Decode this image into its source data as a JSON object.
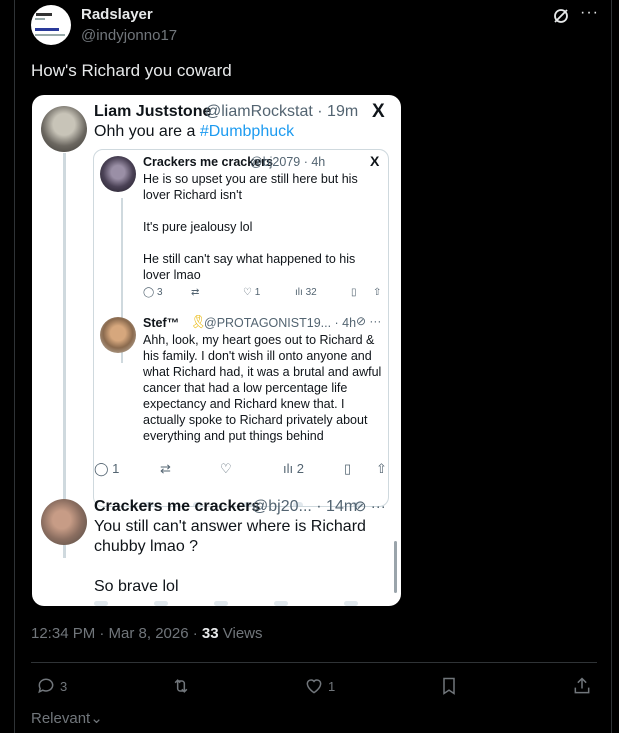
{
  "post": {
    "author_name": "Radslayer",
    "author_handle": "@indyjonno17",
    "avatar_lines": [
      "Trust Red",
      "Account suspended"
    ],
    "text": "How's Richard you coward",
    "timestamp": "12:34 PM · Mar 8, 2026 · ",
    "views_count": "33",
    "views_label": " Views",
    "stats": {
      "replies": "3",
      "likes": "1"
    },
    "sort_label": "Relevant"
  },
  "screenshot": {
    "main": {
      "name": "Liam Juststone",
      "meta": "@liamRockstat · 19m",
      "text_prefix": "Ohh you are a ",
      "hashtag": "#Dumbphuck",
      "x_logo": "X",
      "actions": {
        "replies": "1",
        "views": "2"
      }
    },
    "quoted": {
      "name": "Crackers me crackers",
      "meta": "@bj2079 · 4h",
      "x_logo": "X",
      "paragraphs": [
        "He is so upset you are still here but his lover Richard isn't",
        "It's pure jealousy lol",
        "He still can't say what happened to his lover lmao"
      ],
      "actions": {
        "replies": "3",
        "likes": "1",
        "views": "32"
      }
    },
    "quoted_reply": {
      "name": "Stef™",
      "meta": "@PROTAGONIST19... · 4h",
      "text": "Ahh, look, my heart goes out to Richard & his family. I don't wish ill onto anyone and what Richard had, it was a brutal and awful cancer that had a low percentage life expectancy and Richard knew that. I actually spoke to Richard privately about everything and put things behind"
    },
    "reply": {
      "name": "Crackers me crackers",
      "meta": "@bj20... · 14m",
      "paragraphs": [
        "You still can't answer where is Richard chubby lmao ?",
        "So brave lol"
      ]
    }
  },
  "colors": {
    "accent": "#1d9bf0",
    "bg": "#000000",
    "muted": "#71767b",
    "text": "#e7e9ea"
  },
  "icons": [
    "grok-icon",
    "more-icon",
    "reply-icon",
    "retweet-icon",
    "like-icon",
    "views-icon",
    "bookmark-icon",
    "share-icon",
    "chevron-down-icon",
    "awareness-ribbon-icon"
  ]
}
